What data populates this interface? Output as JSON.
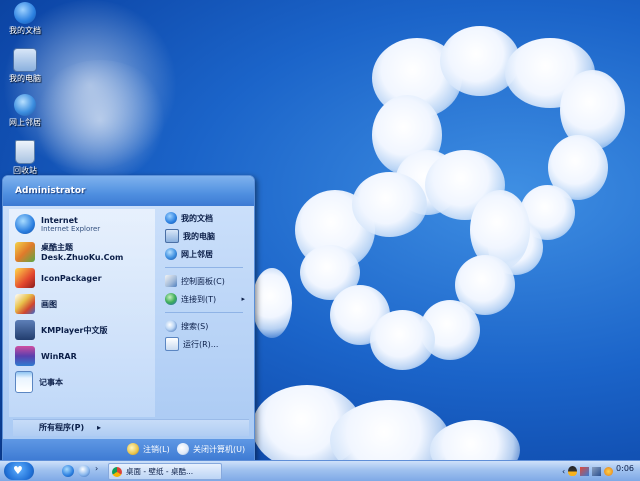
{
  "desktop": {
    "icons": [
      {
        "label": "我的文档",
        "icon": "my-documents-icon"
      },
      {
        "label": "我的电脑",
        "icon": "my-computer-icon"
      },
      {
        "label": "网上邻居",
        "icon": "network-icon"
      },
      {
        "label": "回收站",
        "icon": "recycle-bin-icon"
      }
    ]
  },
  "start_menu": {
    "user": "Administrator",
    "pinned": [
      {
        "title": "Internet",
        "subtitle": "Internet Explorer",
        "icon": "internet-explorer-icon"
      },
      {
        "title": "桌酷主题Desk.ZhuoKu.Com",
        "icon": "zhuoku-theme-icon"
      },
      {
        "title": "IconPackager",
        "icon": "iconpackager-icon"
      },
      {
        "title": "画图",
        "icon": "paint-icon"
      },
      {
        "title": "KMPlayer中文版",
        "icon": "kmplayer-icon"
      },
      {
        "title": "WinRAR",
        "icon": "winrar-icon"
      },
      {
        "title": "记事本",
        "icon": "notepad-icon"
      }
    ],
    "all_programs": "所有程序(P)",
    "places": [
      {
        "label": "我的文档",
        "icon": "my-documents-icon"
      },
      {
        "label": "我的电脑",
        "icon": "my-computer-icon"
      },
      {
        "label": "网上邻居",
        "icon": "network-icon"
      },
      {
        "label": "控制面板(C)",
        "icon": "control-panel-icon"
      },
      {
        "label": "连接到(T)",
        "icon": "connect-to-icon"
      },
      {
        "label": "搜索(S)",
        "icon": "search-icon"
      },
      {
        "label": "运行(R)...",
        "icon": "run-icon"
      }
    ],
    "logoff": "注销(L)",
    "shutdown": "关闭计算机(U)"
  },
  "taskbar": {
    "task": "桌面 - 壁纸 - 桌酷...",
    "clock": "0:06"
  },
  "colors": {
    "sky": "#1b64c9",
    "menu_header": "#4f8fe0",
    "taskbar": "#9fc1ef"
  }
}
